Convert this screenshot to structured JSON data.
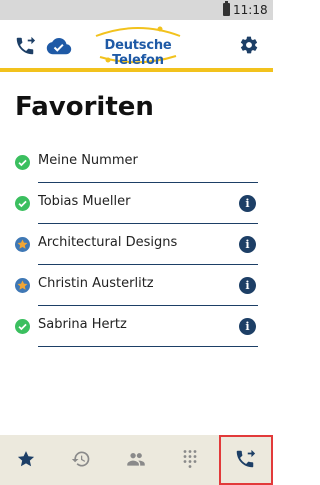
{
  "status_bar": {
    "time": "11:18"
  },
  "header": {
    "brand": "Deutsche Telefon",
    "icons": [
      "call-forward-icon",
      "cloud-check-icon",
      "gear-icon"
    ]
  },
  "page": {
    "title": "Favoriten"
  },
  "favorites": [
    {
      "name": "Meine Nummer",
      "status": "check",
      "info": false
    },
    {
      "name": "Tobias Mueller",
      "status": "check",
      "info": true
    },
    {
      "name": "Architectural Designs",
      "status": "star",
      "info": true
    },
    {
      "name": "Christin Austerlitz",
      "status": "star",
      "info": true
    },
    {
      "name": "Sabrina Hertz",
      "status": "check",
      "info": true
    }
  ],
  "info_glyph": "i",
  "bottom_nav": {
    "items": [
      "star-icon",
      "history-icon",
      "contacts-icon",
      "dialpad-icon",
      "call-forward-icon"
    ],
    "highlighted": "call-forward-icon"
  },
  "colors": {
    "accent_yellow": "#f2c21d",
    "brand_blue": "#1f5aa6",
    "navy": "#1d3f66",
    "check_green": "#3bbf5f",
    "star_orange": "#f0a534",
    "star_bg": "#3f78b5",
    "nav_bg": "#ece9dd",
    "highlight_red": "#e23a3a"
  }
}
